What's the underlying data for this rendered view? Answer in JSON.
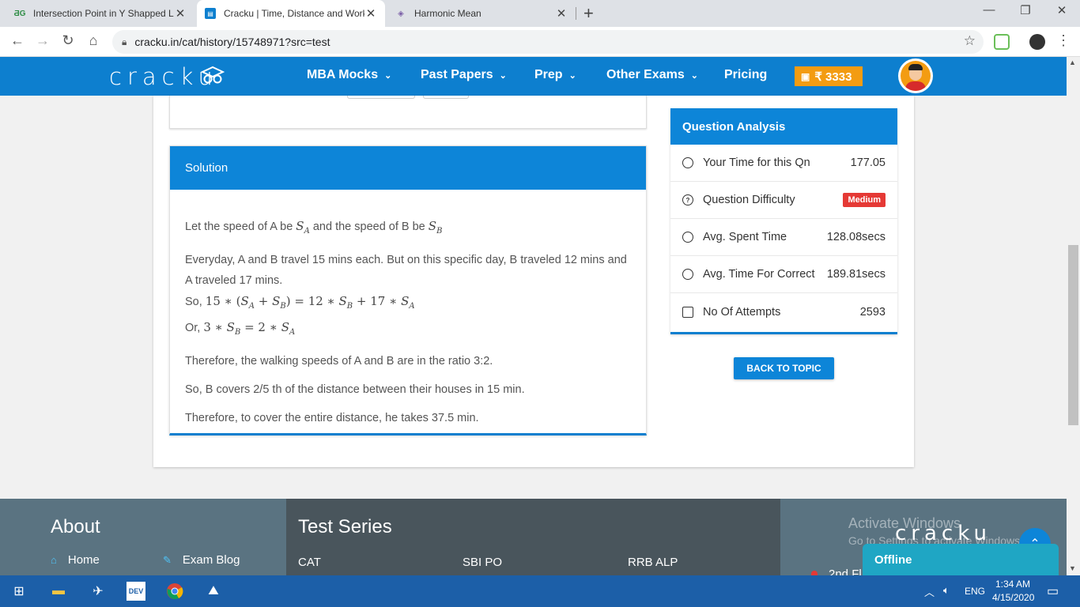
{
  "browser": {
    "tabs": [
      {
        "label": "Intersection Point in Y Shapped L",
        "favicon": "gfg-icon",
        "active": false
      },
      {
        "label": "Cracku | Time, Distance and Work",
        "favicon": "cracku-icon",
        "active": true
      },
      {
        "label": "Harmonic Mean",
        "favicon": "calculator-icon",
        "active": false
      }
    ],
    "url": "cracku.in/cat/history/15748971?src=test"
  },
  "header": {
    "logo": "cracku",
    "nav": [
      {
        "label": "MBA Mocks",
        "dropdown": true
      },
      {
        "label": "Past Papers",
        "dropdown": true
      },
      {
        "label": "Prep",
        "dropdown": true
      },
      {
        "label": "Other Exams",
        "dropdown": true
      },
      {
        "label": "Pricing",
        "dropdown": false
      }
    ],
    "wallet": "₹ 3333"
  },
  "solution": {
    "title": "Solution",
    "line1_pre": "Let the speed of A be",
    "line1_mid": "and the speed of B be",
    "line2": "Everyday, A and B travel 15 mins each. But on this specific day, B traveled 12 mins and A traveled 17 mins.",
    "line3_pre": "So,",
    "line4_pre": "Or,",
    "line5": "Therefore, the walking speeds of A and B are in the ratio 3:2.",
    "line6": "So, B covers 2/5 th of the distance between their houses in 15 min.",
    "line7": "Therefore, to cover the entire distance, he takes 37.5 min."
  },
  "analysis": {
    "title": "Question Analysis",
    "rows": [
      {
        "label": "Your Time for this Qn",
        "value": "177.05",
        "icon": "stopwatch-icon"
      },
      {
        "label": "Question Difficulty",
        "value": "Medium",
        "icon": "help-circle-icon"
      },
      {
        "label": "Avg. Spent Time",
        "value": "128.08secs",
        "icon": "clock-icon"
      },
      {
        "label": "Avg. Time For Correct",
        "value": "189.81secs",
        "icon": "alarm-icon"
      },
      {
        "label": "No Of Attempts",
        "value": "2593",
        "icon": "edit-icon"
      }
    ],
    "back_button": "BACK TO TOPIC"
  },
  "footer": {
    "about_title": "About",
    "about_links": [
      "Home",
      "Exam Blog"
    ],
    "test_series_title": "Test Series",
    "test_series_links": [
      "CAT",
      "SBI PO",
      "RRB ALP"
    ],
    "watermark_line1": "Activate Windows",
    "watermark_line2": "Go to Settings to activate Windows.",
    "logo": "cracku",
    "offline": "Offline",
    "cut_text": "2nd Fl"
  },
  "taskbar": {
    "lang": "ENG",
    "time": "1:34 AM",
    "date": "4/15/2020"
  },
  "colors": {
    "primary": "#0d7fcf",
    "wallet": "#f39c12",
    "badge_medium": "#e53935",
    "footer_dark": "#49555c",
    "footer_light": "#5a7381"
  }
}
